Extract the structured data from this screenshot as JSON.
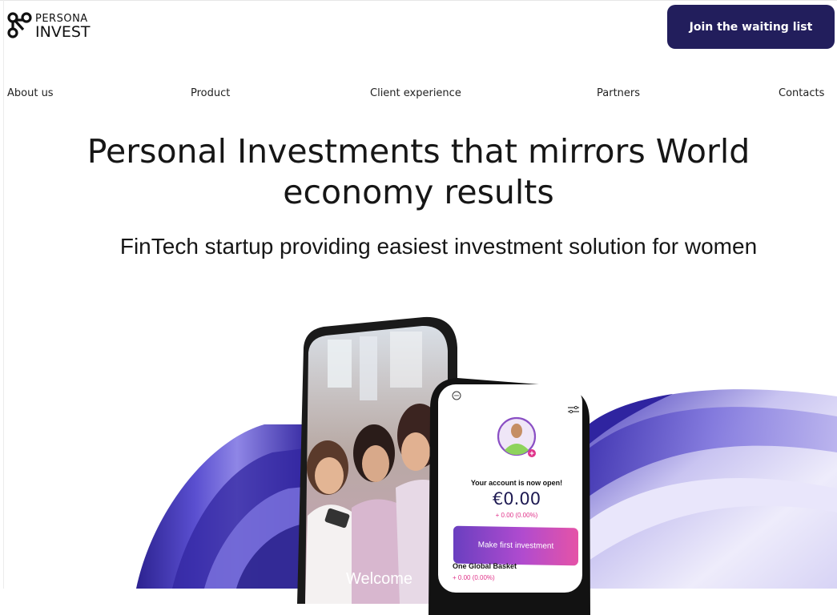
{
  "brand": {
    "line1": "PERSONA",
    "line2": "INVEST",
    "logo_icon": "three-node-link-icon"
  },
  "header": {
    "cta_label": "Join the waiting list"
  },
  "nav": {
    "items": [
      "About us",
      "Product",
      "Client experience",
      "Partners",
      "Contacts"
    ]
  },
  "hero": {
    "headline_line1": "Personal Investments that mirrors World",
    "headline_line2": "economy results",
    "subhead": "FinTech startup providing easiest investment solution for women"
  },
  "phone_screen": {
    "welcome_text": "Welcome",
    "account_status": "Your account is now open!",
    "balance": "€0.00",
    "balance_change": "+ 0.00 (0.00%)",
    "primary_button": "Make first investment",
    "basket_name": "One Global Basket",
    "basket_change": "+ 0.00 (0.00%)"
  },
  "colors": {
    "cta_bg": "#221e5c",
    "accent_purple": "#5a4fc0",
    "pink": "#e0338a"
  }
}
